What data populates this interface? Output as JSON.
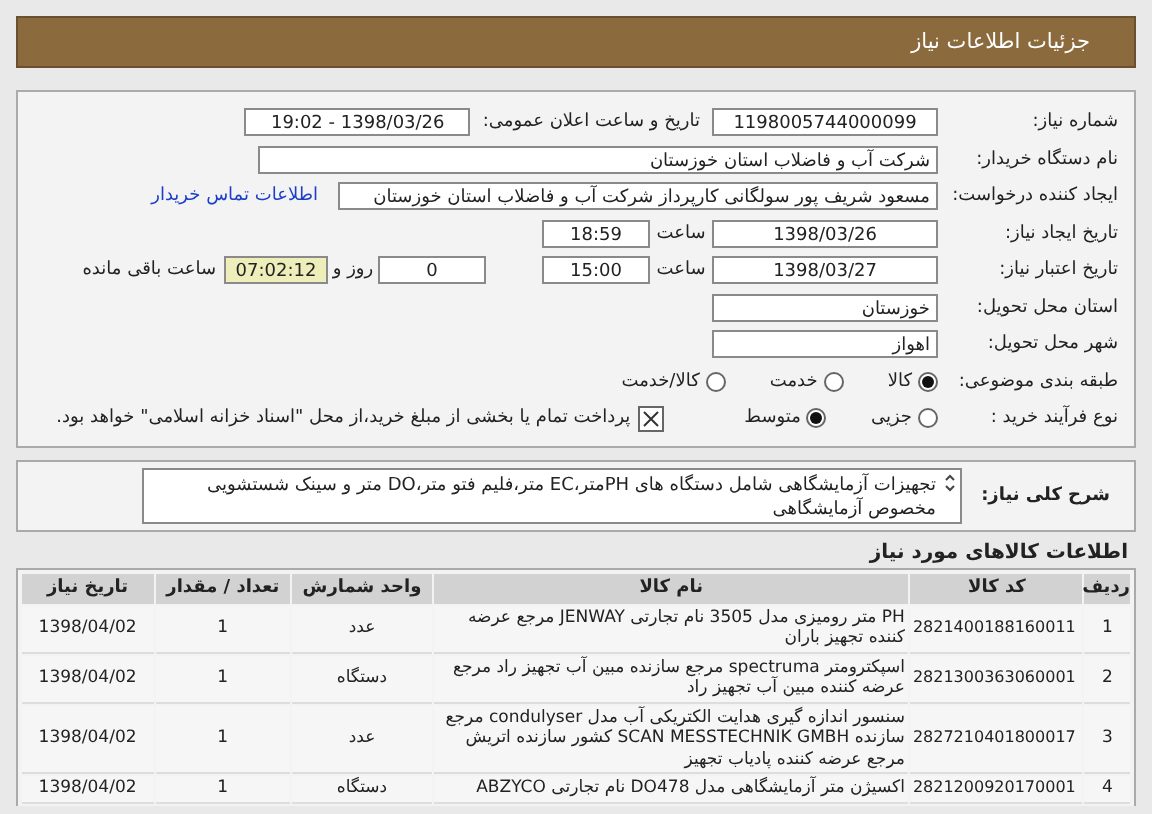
{
  "header": {
    "title": "جزئیات اطلاعات نیاز"
  },
  "details": {
    "need_number": {
      "label": "شماره نیاز:",
      "value": "1198005744000099"
    },
    "announce": {
      "label": "تاریخ و ساعت اعلان عمومی:",
      "value": "1398/03/26 - 19:02"
    },
    "buyer": {
      "label": "نام دستگاه خریدار:",
      "value": "شرکت آب و فاضلاب استان خوزستان"
    },
    "creator": {
      "label": "ایجاد کننده درخواست:",
      "value": "مسعود شریف پور سولگانی کارپرداز شرکت آب و فاضلاب استان خوزستان",
      "link": "اطلاعات تماس خریدار"
    },
    "created": {
      "label": "تاریخ ایجاد نیاز:",
      "date": "1398/03/26",
      "time_label": "ساعت",
      "time": "18:59"
    },
    "validity": {
      "label": "تاریخ اعتبار نیاز:",
      "date": "1398/03/27",
      "time_label": "ساعت",
      "time": "15:00",
      "days": "0",
      "days_label": "روز و",
      "remaining": "07:02:12",
      "remaining_label": "ساعت باقی مانده"
    },
    "province": {
      "label": "استان محل تحویل:",
      "value": "خوزستان"
    },
    "city": {
      "label": "شهر محل تحویل:",
      "value": "اهواز"
    },
    "category": {
      "label": "طبقه بندی موضوعی:",
      "options": [
        {
          "label": "کالا",
          "selected": true
        },
        {
          "label": "خدمت",
          "selected": false
        },
        {
          "label": "کالا/خدمت",
          "selected": false
        }
      ]
    },
    "process": {
      "label": "نوع فرآیند خرید :",
      "options": [
        {
          "label": "جزیی",
          "selected": false
        },
        {
          "label": "متوسط",
          "selected": true
        }
      ],
      "treasury": {
        "checked": true,
        "text": "پرداخت تمام یا بخشی از مبلغ خرید،از محل \"اسناد خزانه اسلامی\" خواهد بود."
      }
    }
  },
  "description": {
    "label": "شرح کلی نیاز:",
    "text": "تجهیزات آزمایشگاهی شامل دستگاه های  PHمتر،EC متر،فلیم فتو متر،DO متر و سینک شستشویی مخصوص آزمایشگاهی"
  },
  "goods": {
    "title": "اطلاعات کالاهای مورد نیاز",
    "columns": [
      "ردیف",
      "کد کالا",
      "نام کالا",
      "واحد شمارش",
      "تعداد / مقدار",
      "تاریخ نیاز"
    ],
    "rows": [
      [
        "1",
        "2821400188160011",
        "PH متر رومیزی مدل 3505 نام تجارتی JENWAY مرجع عرضه کننده تجهیز باران",
        "عدد",
        "1",
        "1398/04/02"
      ],
      [
        "2",
        "2821300363060001",
        "اسپکترومتر spectruma مرجع سازنده مبین آب تجهیز راد مرجع عرضه کننده مبین آب تجهیز راد",
        "دستگاه",
        "1",
        "1398/04/02"
      ],
      [
        "3",
        "2827210401800017",
        "سنسور اندازه گیری هدایت الکتریکی آب مدل condulyser مرجع سازنده SCAN MESSTECHNIK GMBH کشور سازنده اتریش مرجع عرضه کننده پادیاب تجهیز",
        "عدد",
        "1",
        "1398/04/02"
      ],
      [
        "4",
        "2821200920170001",
        "اکسیژن متر آزمایشگاهی مدل DO478 نام تجارتی ABZYCO",
        "دستگاه",
        "1",
        "1398/04/02"
      ]
    ]
  }
}
